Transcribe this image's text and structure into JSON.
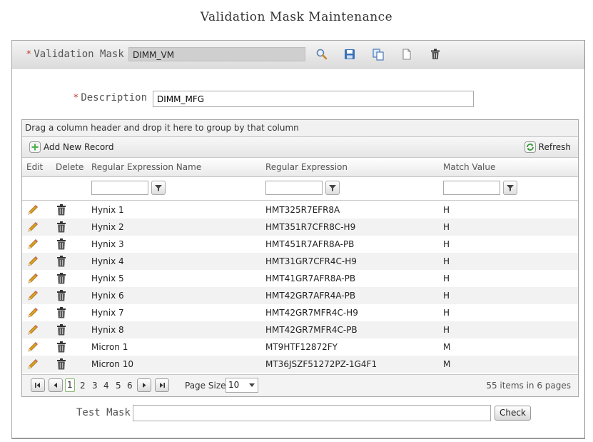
{
  "title": "Validation Mask Maintenance",
  "mask": {
    "required_mark": "*",
    "label": "Validation Mask",
    "value": "DIMM_VM",
    "toolbar_icons": [
      "search-icon",
      "save-icon",
      "copy-icon",
      "new-document-icon",
      "delete-icon"
    ]
  },
  "description": {
    "required_mark": "*",
    "label": "Description",
    "value": "DIMM_MFG"
  },
  "grid": {
    "group_hint": "Drag a column header and drop it here to group by that column",
    "add_label": "Add New Record",
    "refresh_label": "Refresh",
    "columns": [
      "Edit",
      "Delete",
      "Regular Expression Name",
      "Regular Expression",
      "Match Value"
    ],
    "rows": [
      {
        "name": "Hynix 1",
        "expr": "HMT325R7EFR8A",
        "match": "H"
      },
      {
        "name": "Hynix 2",
        "expr": "HMT351R7CFR8C-H9",
        "match": "H"
      },
      {
        "name": "Hynix 3",
        "expr": "HMT451R7AFR8A-PB",
        "match": "H"
      },
      {
        "name": "Hynix 4",
        "expr": "HMT31GR7CFR4C-H9",
        "match": "H"
      },
      {
        "name": "Hynix 5",
        "expr": "HMT41GR7AFR8A-PB",
        "match": "H"
      },
      {
        "name": "Hynix 6",
        "expr": "HMT42GR7AFR4A-PB",
        "match": "H"
      },
      {
        "name": "Hynix 7",
        "expr": "HMT42GR7MFR4C-H9",
        "match": "H"
      },
      {
        "name": "Hynix 8",
        "expr": "HMT42GR7MFR4C-PB",
        "match": "H"
      },
      {
        "name": "Micron 1",
        "expr": "MT9HTF12872FY",
        "match": "M"
      },
      {
        "name": "Micron 10",
        "expr": "MT36JSZF51272PZ-1G4F1",
        "match": "M"
      }
    ]
  },
  "pager": {
    "pages": [
      "1",
      "2",
      "3",
      "4",
      "5",
      "6"
    ],
    "current_page": "1",
    "page_size_label": "Page Size:",
    "page_size": "10",
    "info": "55 items in 6 pages"
  },
  "test": {
    "label": "Test Mask",
    "value": "",
    "button": "Check"
  },
  "colors": {
    "required": "#c0392b",
    "add_icon": "#4caf50",
    "refresh_icon": "#3a9b3a",
    "save_icon": "#3b6fb6",
    "pencil": "#e0a020"
  }
}
